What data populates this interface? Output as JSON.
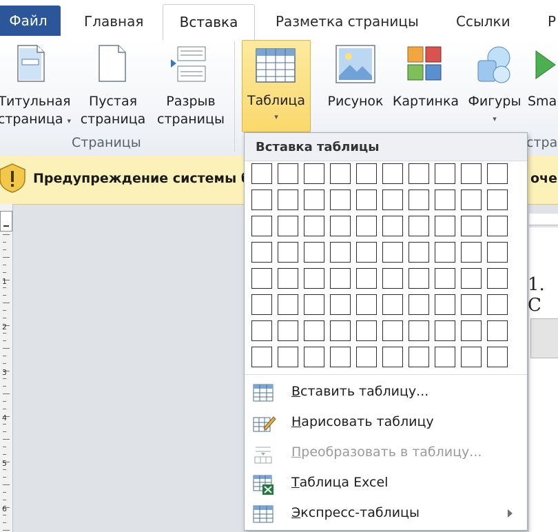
{
  "tabs": {
    "file": "Файл",
    "home": "Главная",
    "insert": "Вставка",
    "page_layout": "Разметка страницы",
    "references": "Ссылки",
    "more": "Р"
  },
  "ribbon": {
    "cover_page": [
      "Титульная",
      "страница"
    ],
    "blank_page": [
      "Пустая",
      "страница"
    ],
    "page_break": [
      "Разрыв",
      "страницы"
    ],
    "table": "Таблица",
    "picture": "Рисунок",
    "clipart": "Картинка",
    "shapes": "Фигуры",
    "smartart": "Sma",
    "group_pages": "Страницы",
    "group_illustrations_fragment": "стра"
  },
  "warning": {
    "text": "Предупреждение системы б",
    "right_fragment": "очен"
  },
  "document": {
    "heading_fragment": "1. С",
    "ruler_numbers": [
      "1",
      "2",
      "3",
      "4",
      "5",
      "6"
    ]
  },
  "dropdown": {
    "title": "Вставка таблицы",
    "grid_rows": 8,
    "grid_cols": 10,
    "items": [
      {
        "label": "Вставить таблицу...",
        "accel": "В",
        "rest": "ставить таблицу...",
        "enabled": true,
        "icon": "insert-table-icon"
      },
      {
        "label": "Нарисовать таблицу",
        "accel": "Н",
        "rest": "арисовать таблицу",
        "enabled": true,
        "icon": "draw-table-icon"
      },
      {
        "label": "Преобразовать в таблицу...",
        "accel": "П",
        "rest": "реобразовать в таблицу...",
        "enabled": false,
        "icon": "convert-to-table-icon"
      },
      {
        "label": "Таблица Excel",
        "accel": "Т",
        "rest": "аблица Excel",
        "enabled": true,
        "icon": "excel-table-icon"
      },
      {
        "label": "Экспресс-таблицы",
        "accel": "Э",
        "rest": "кспресс-таблицы",
        "enabled": true,
        "icon": "quick-tables-icon",
        "submenu": true
      }
    ]
  },
  "colors": {
    "file_tab": "#2b579a",
    "table_button_highlight": "#f9d96d",
    "warning_bar": "#fcf1b8"
  }
}
